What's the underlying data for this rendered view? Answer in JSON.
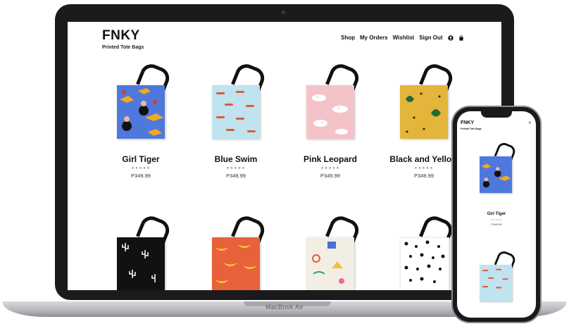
{
  "site": {
    "brand": "FNKY",
    "tagline": "Printed Tote Bags"
  },
  "nav": {
    "links": [
      "Shop",
      "My Orders",
      "Wishlist",
      "Sign Out"
    ],
    "icons": [
      "user-icon",
      "bag-icon"
    ]
  },
  "products_row1": [
    {
      "name": "Girl Tiger",
      "stars": "★★★★★",
      "price": "P349.99",
      "pattern": "girl-tiger",
      "color": "#4f78dd"
    },
    {
      "name": "Blue Swim",
      "stars": "★★★★★",
      "price": "P349.99",
      "pattern": "blue-swim",
      "color": "#bfe3ef"
    },
    {
      "name": "Pink Leopard",
      "stars": "★★★★★",
      "price": "P349.99",
      "pattern": "pink-leopard",
      "color": "#f4c3c8"
    },
    {
      "name": "Black and Yellow",
      "stars": "★★★★★",
      "price": "P349.99",
      "pattern": "black-yellow",
      "color": "#e3b53a"
    }
  ],
  "products_row2": [
    {
      "pattern": "cactus",
      "color": "#111111"
    },
    {
      "pattern": "banana",
      "color": "#e8613a"
    },
    {
      "pattern": "abstract",
      "color": "#f3eee4"
    },
    {
      "pattern": "dots",
      "color": "#ffffff"
    }
  ],
  "laptop": {
    "label": "MacBook Air"
  },
  "mobile": {
    "brand": "FNKY",
    "tagline": "Printed Tote Bags",
    "menu": "≡",
    "product": {
      "name": "Girl Tiger",
      "stars": "★★★★★",
      "price": "P349.99"
    }
  }
}
